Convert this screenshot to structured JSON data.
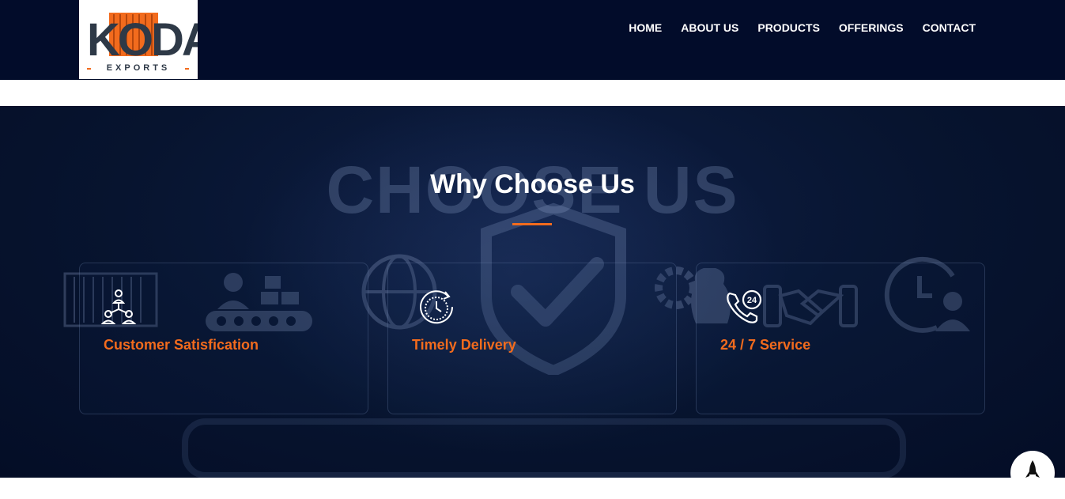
{
  "logo": {
    "brand": "KODA",
    "sub": "EXPORTS"
  },
  "nav": {
    "items": [
      "HOME",
      "ABOUT US",
      "PRODUCTS",
      "OFFERINGS",
      "CONTACT"
    ]
  },
  "section": {
    "watermark": "CHOOSE US",
    "title": "Why Choose Us"
  },
  "cards": [
    {
      "label": "Customer Satisfication",
      "icon": "team-network-icon"
    },
    {
      "label": "Timely Delivery",
      "icon": "clock-delivery-icon"
    },
    {
      "label": "24 / 7 Service",
      "icon": "phone-24-icon"
    }
  ],
  "colors": {
    "header": "#020c2a",
    "accent": "#f26b1d",
    "hero": "#07142f",
    "text": "#ffffff"
  }
}
